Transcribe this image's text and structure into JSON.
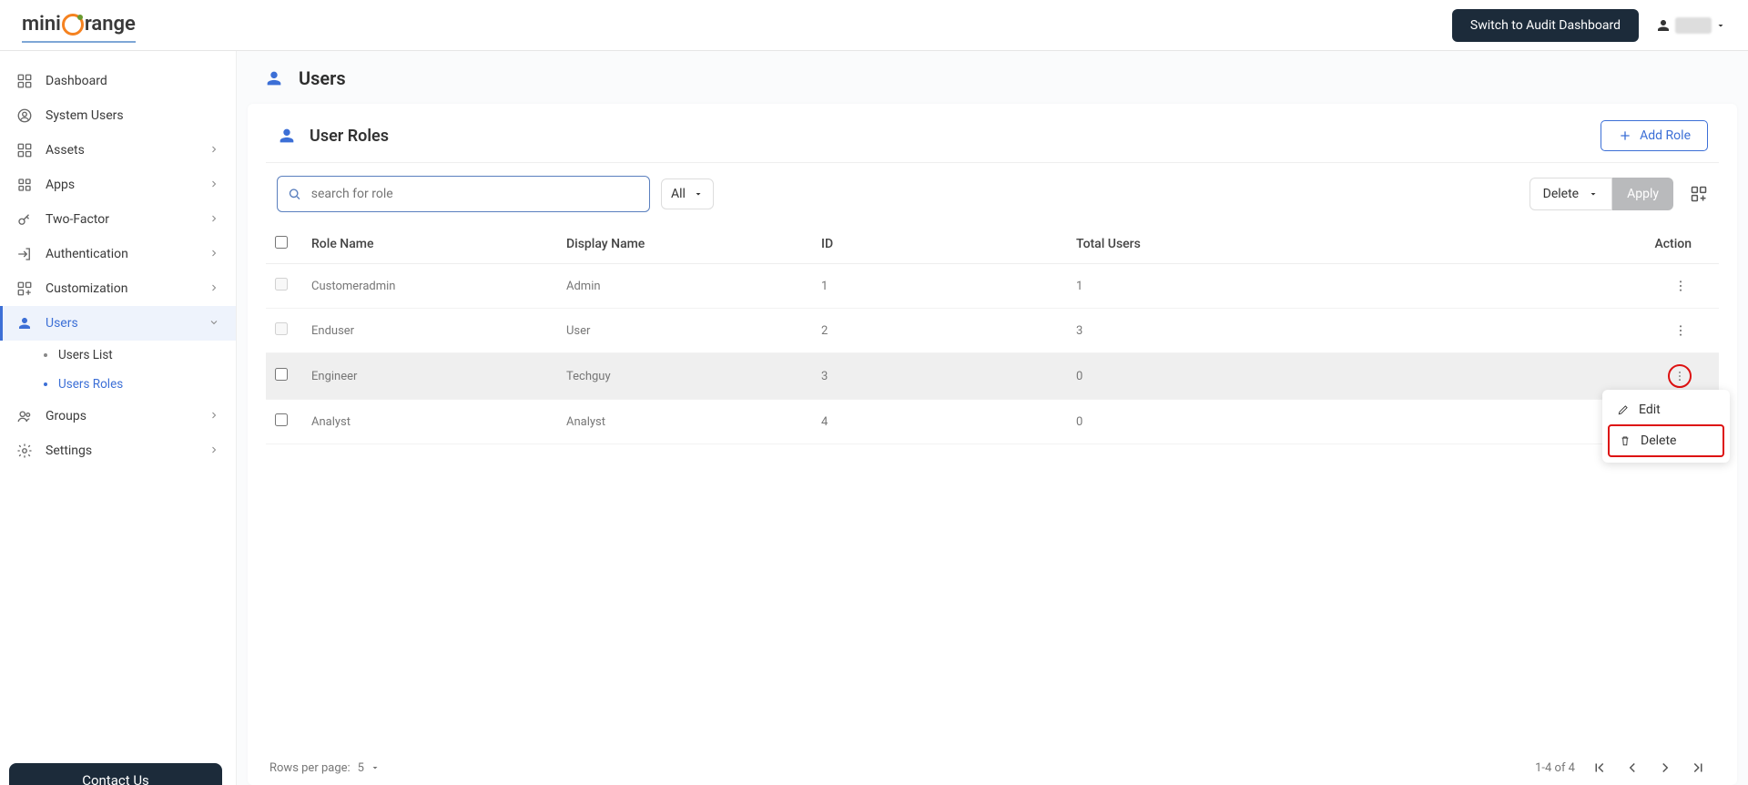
{
  "brand": {
    "name_pre": "mini",
    "name_post": "range"
  },
  "header": {
    "switch_button": "Switch to Audit Dashboard"
  },
  "sidebar": {
    "items": [
      {
        "label": "Dashboard",
        "icon": "grid",
        "expandable": false
      },
      {
        "label": "System Users",
        "icon": "user-circle",
        "expandable": false
      },
      {
        "label": "Assets",
        "icon": "squares",
        "expandable": true
      },
      {
        "label": "Apps",
        "icon": "apps",
        "expandable": true
      },
      {
        "label": "Two-Factor",
        "icon": "key",
        "expandable": true
      },
      {
        "label": "Authentication",
        "icon": "login",
        "expandable": true
      },
      {
        "label": "Customization",
        "icon": "grid-plus",
        "expandable": true
      },
      {
        "label": "Users",
        "icon": "person",
        "expandable": true,
        "active": true
      },
      {
        "label": "Groups",
        "icon": "people",
        "expandable": true
      },
      {
        "label": "Settings",
        "icon": "gear",
        "expandable": true
      }
    ],
    "users_sub": [
      {
        "label": "Users List"
      },
      {
        "label": "Users Roles",
        "active": true
      }
    ],
    "contact": "Contact Us"
  },
  "page": {
    "title": "Users",
    "section_title": "User Roles",
    "add_role": "Add Role",
    "search_placeholder": "search for role",
    "filter_all": "All",
    "bulk_action": "Delete",
    "apply": "Apply"
  },
  "table": {
    "headers": {
      "role_name": "Role Name",
      "display_name": "Display Name",
      "id": "ID",
      "total_users": "Total Users",
      "action": "Action"
    },
    "rows": [
      {
        "role_name": "Customeradmin",
        "display_name": "Admin",
        "id": "1",
        "total_users": "1",
        "locked": true
      },
      {
        "role_name": "Enduser",
        "display_name": "User",
        "id": "2",
        "total_users": "3",
        "locked": true
      },
      {
        "role_name": "Engineer",
        "display_name": "Techguy",
        "id": "3",
        "total_users": "0",
        "locked": false,
        "highlight": true,
        "menu_open": true
      },
      {
        "role_name": "Analyst",
        "display_name": "Analyst",
        "id": "4",
        "total_users": "0",
        "locked": false
      }
    ]
  },
  "action_menu": {
    "edit": "Edit",
    "delete": "Delete"
  },
  "pagination": {
    "rows_per_page_label": "Rows per page:",
    "rows_per_page_value": "5",
    "range": "1-4 of 4"
  }
}
